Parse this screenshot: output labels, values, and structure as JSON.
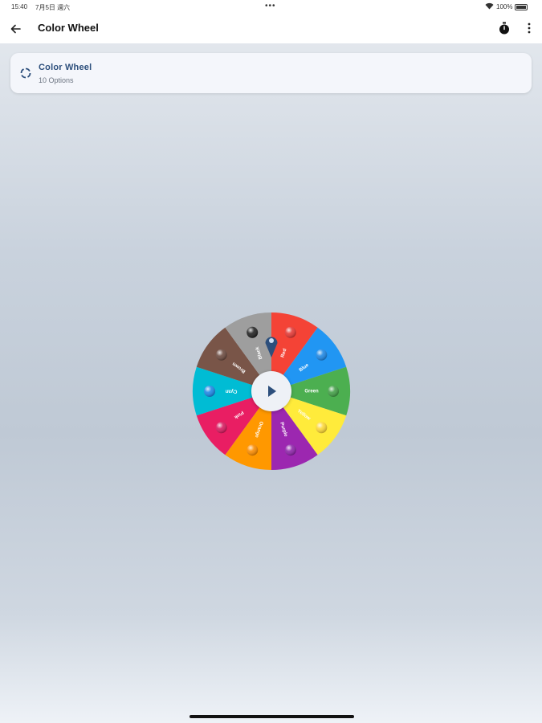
{
  "status_bar": {
    "time": "15:40",
    "date": "7月5日 週六",
    "dots": "•••",
    "battery": "100%"
  },
  "app_bar": {
    "back_icon": "arrow-left-icon",
    "title": "Color Wheel",
    "timer_icon": "stopwatch-icon",
    "more_icon": "more-vertical-icon"
  },
  "wheel_card": {
    "icon": "spinner-icon",
    "title": "Color Wheel",
    "subtitle": "10 Options"
  },
  "wheel": {
    "options": [
      {
        "label": "Red",
        "color": "#f44336"
      },
      {
        "label": "Blue",
        "color": "#2196f3"
      },
      {
        "label": "Green",
        "color": "#4caf50"
      },
      {
        "label": "Yellow",
        "color": "#ffeb3b"
      },
      {
        "label": "Purple",
        "color": "#9c27b0"
      },
      {
        "label": "Orange",
        "color": "#ff9800"
      },
      {
        "label": "Pink",
        "color": "#e91e63"
      },
      {
        "label": "Cyan",
        "color": "#00bcd4"
      },
      {
        "label": "Brown",
        "color": "#795548"
      },
      {
        "label": "Black",
        "color": "#9e9e9e"
      }
    ],
    "ball_colors": [
      "#e53935",
      "#1e88e5",
      "#43a047",
      "#fdd835",
      "#8e24aa",
      "#fb8c00",
      "#d81b60",
      "#1e88e5",
      "#6d4c41",
      "#212121"
    ],
    "spin_icon": "play-icon",
    "accent_color": "#2d4f7c"
  }
}
